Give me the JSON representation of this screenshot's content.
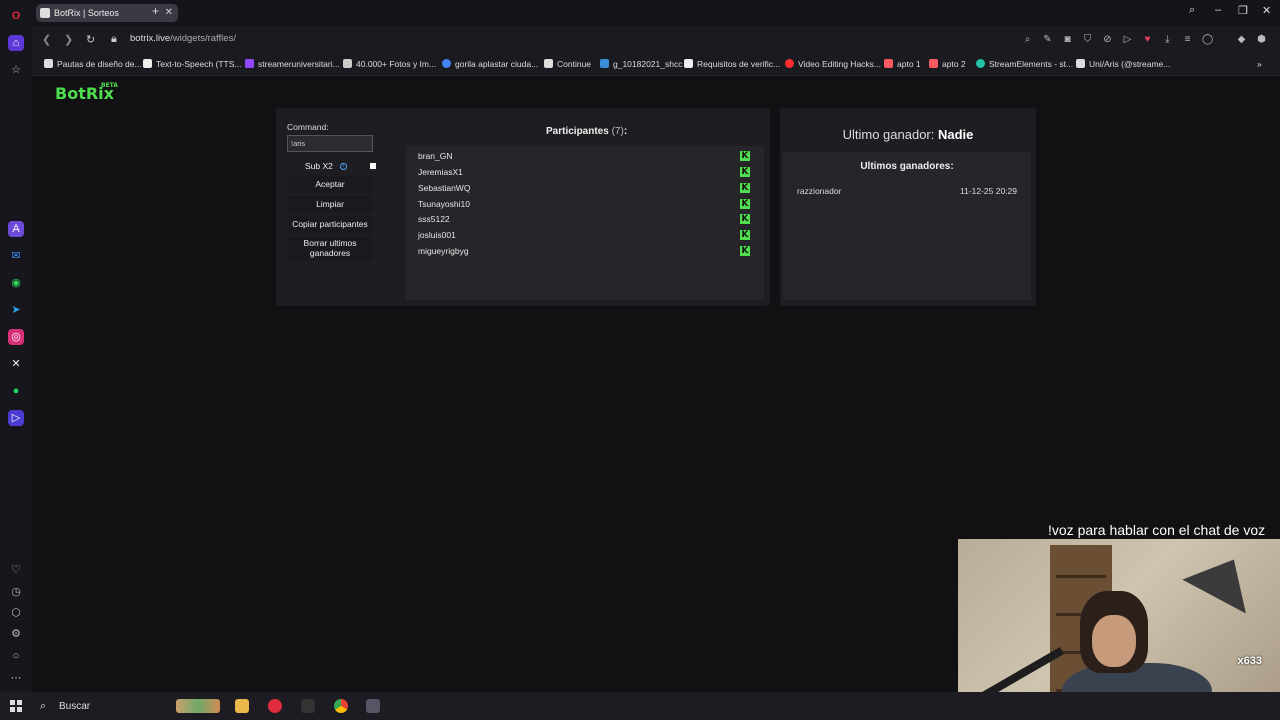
{
  "browser": {
    "tab_title": "BotRix | Sorteos",
    "tab_close": "✕",
    "new_tab": "+",
    "url_host": "botrix.live",
    "url_path": "/widgets/raffles/",
    "bookmarks": [
      "Pautas de diseño de...",
      "Text-to-Speech (TTS...",
      "streameruniversitari...",
      "40.000+ Fotos y Im...",
      "gorila aplastar ciuda...",
      "Continue",
      "g_10182021_shcc",
      "Requisitos de verific...",
      "Video Editing Hacks...",
      "apto 1",
      "apto 2",
      "StreamElements - st...",
      "Uni/Aris (@streame..."
    ]
  },
  "brand": {
    "logo": "BotRix",
    "badge": "BETA"
  },
  "raffle": {
    "command_label": "Command:",
    "command_value": "!aris",
    "sub_label": "Sub X2",
    "info_glyph": "i",
    "buttons": {
      "accept": "Aceptar",
      "clear": "Limpiar",
      "copy": "Copiar participantes",
      "delete_winners": "Borrar ultimos ganadores"
    }
  },
  "participants": {
    "title": "Participantes",
    "count": "(7)",
    "colon": ":",
    "platform_glyph": "K",
    "list": [
      "bran_GN",
      "JeremiasX1",
      "SebastianWQ",
      "Tsunayoshi10",
      "sss5122",
      "josluis001",
      "migueyrigbyg"
    ]
  },
  "winners": {
    "last_winner_label": "Ultimo ganador:",
    "last_winner_value": "Nadie",
    "recent_title": "Ultimos ganadores:",
    "recent": [
      {
        "name": "razzionador",
        "date": "11-12-25 20:29"
      }
    ]
  },
  "stream_overlay": {
    "text": "!voz para hablar con el chat de voz",
    "badge": "x633"
  },
  "taskbar": {
    "search_label": "Buscar"
  },
  "colors": {
    "accent_green": "#4ede4e",
    "panel": "#1e1e22",
    "info_blue": "#4aa3ff"
  }
}
